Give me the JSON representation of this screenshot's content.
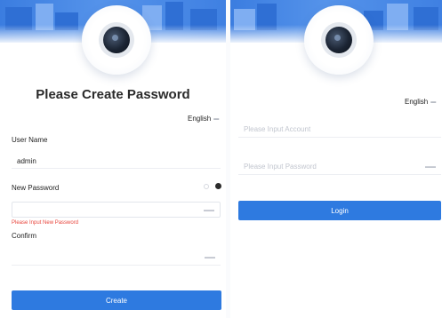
{
  "colors": {
    "primary": "#2e7ae0",
    "error": "#e8453c",
    "banner": "#4a8be6"
  },
  "create_panel": {
    "title": "Please Create Password",
    "language": "English",
    "username_label": "User Name",
    "username_value": "admin",
    "new_password_label": "New Password",
    "new_password_error": "Please Input New Password",
    "confirm_label": "Confirm",
    "create_button": "Create"
  },
  "login_panel": {
    "language": "English",
    "account_placeholder": "Please Input Account",
    "password_placeholder": "Please Input Password",
    "login_button": "Login"
  },
  "icons": {
    "camera": "camera-lens-icon",
    "language_dropdown": "chevron-down-icon",
    "password_visibility": "eye-icon"
  }
}
